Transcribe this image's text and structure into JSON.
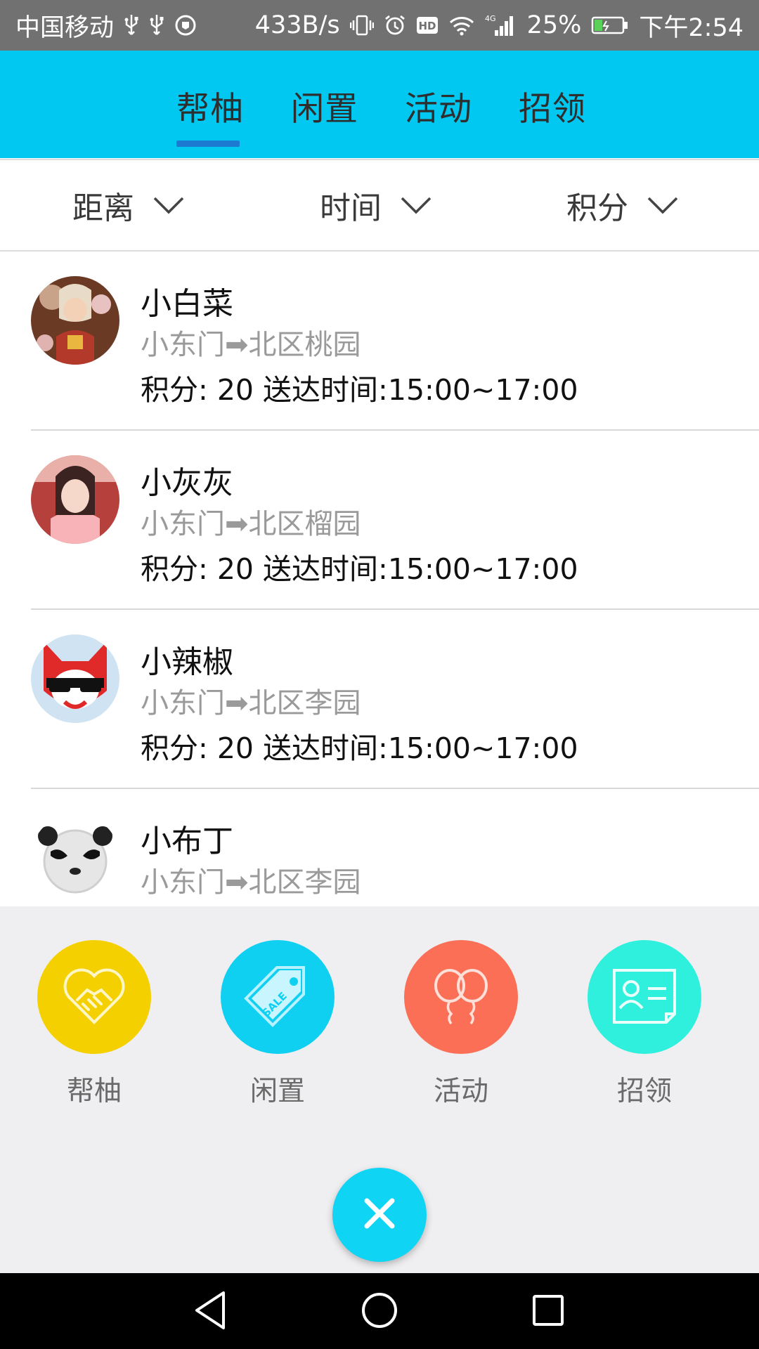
{
  "status_bar": {
    "carrier": "中国移动",
    "speed": "433B/s",
    "network": "4G",
    "battery": "25%",
    "time": "下午2:54",
    "icons": [
      "usb-icon",
      "usb-icon",
      "shield-icon",
      "vibrate-icon",
      "alarm-icon",
      "hd-icon",
      "wifi-icon",
      "signal-icon",
      "battery-icon"
    ]
  },
  "tabs": [
    {
      "label": "帮柚",
      "active": true
    },
    {
      "label": "闲置",
      "active": false
    },
    {
      "label": "活动",
      "active": false
    },
    {
      "label": "招领",
      "active": false
    }
  ],
  "filters": [
    {
      "label": "距离"
    },
    {
      "label": "时间"
    },
    {
      "label": "积分"
    }
  ],
  "items": [
    {
      "name": "小白菜",
      "route": "小东门➡北区桃园",
      "meta": "积分: 20 送达时间:15:00~17:00"
    },
    {
      "name": "小灰灰",
      "route": "小东门➡北区榴园",
      "meta": "积分: 20 送达时间:15:00~17:00"
    },
    {
      "name": "小辣椒",
      "route": "小东门➡北区李园",
      "meta": "积分: 20 送达时间:15:00~17:00"
    },
    {
      "name": "小布丁",
      "route": "小东门➡北区李园",
      "meta": ""
    }
  ],
  "menu": [
    {
      "label": "帮柚",
      "icon": "handshake-heart-icon",
      "color": "#f5d000"
    },
    {
      "label": "闲置",
      "icon": "sale-tag-icon",
      "color": "#10d0f2"
    },
    {
      "label": "活动",
      "icon": "balloons-icon",
      "color": "#fa6f55"
    },
    {
      "label": "招领",
      "icon": "id-card-icon",
      "color": "#2ef0dc"
    }
  ],
  "sale_text": "SALE",
  "colors": {
    "header": "#00c8f0",
    "status_bar": "#717171",
    "underline": "#1c7ad0",
    "overlay": "#efeff1"
  }
}
